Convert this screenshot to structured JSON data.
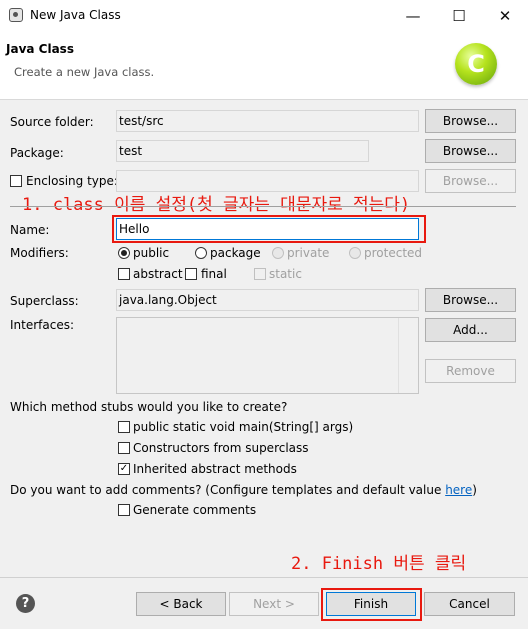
{
  "window": {
    "title": "New Java Class",
    "minimize": "—",
    "maximize": "☐",
    "close": "✕"
  },
  "header": {
    "title": "Java Class",
    "subtitle": "Create a new Java class.",
    "logo_letter": "C"
  },
  "form": {
    "source_folder_label": "Source folder:",
    "source_folder_value": "test/src",
    "package_label": "Package:",
    "package_value": "test",
    "enclosing_type_label": "Enclosing type:",
    "enclosing_type_value": "",
    "name_label": "Name:",
    "name_value": "Hello",
    "modifiers_label": "Modifiers:",
    "mod_public": "public",
    "mod_package": "package",
    "mod_private": "private",
    "mod_protected": "protected",
    "mod_abstract": "abstract",
    "mod_final": "final",
    "mod_static": "static",
    "superclass_label": "Superclass:",
    "superclass_value": "java.lang.Object",
    "interfaces_label": "Interfaces:",
    "browse": "Browse...",
    "add": "Add...",
    "remove": "Remove",
    "stubs_question": "Which method stubs would you like to create?",
    "stub_main": "public static void main(String[] args)",
    "stub_constructors": "Constructors from superclass",
    "stub_inherited": "Inherited abstract methods",
    "stub_main_checked": false,
    "stub_constructors_checked": false,
    "stub_inherited_checked": true,
    "comments_question": "Do you want to add comments? (Configure templates and default value ",
    "comments_link": "here",
    "comments_end": ")",
    "generate_comments": "Generate comments",
    "generate_comments_checked": false
  },
  "annotations": {
    "step1": "1. class 이름 설정(첫 글자는 대문자로 적는다)",
    "step2": "2. Finish 버튼 클릭",
    "color": "#e8190f"
  },
  "footer": {
    "help": "?",
    "back": "< Back",
    "next": "Next >",
    "finish": "Finish",
    "cancel": "Cancel"
  }
}
